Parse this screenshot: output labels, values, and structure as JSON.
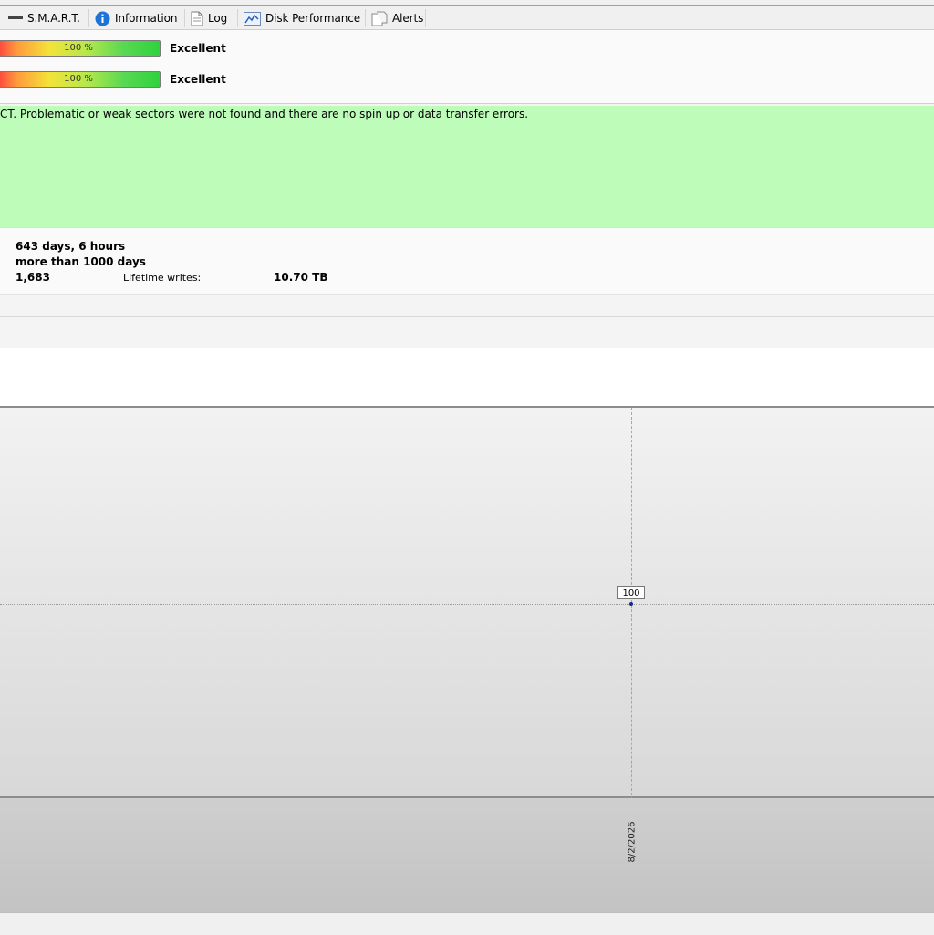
{
  "tabs": [
    {
      "label": "S.M.A.R.T.",
      "icon": "dash-icon"
    },
    {
      "label": "Information",
      "icon": "info-icon"
    },
    {
      "label": "Log",
      "icon": "document-icon"
    },
    {
      "label": "Disk Performance",
      "icon": "performance-chart-icon"
    },
    {
      "label": "Alerts",
      "icon": "alerts-icon"
    }
  ],
  "health": {
    "rows": [
      {
        "percent_text": "100 %",
        "percent": 100,
        "status": "Excellent"
      },
      {
        "percent_text": "100 %",
        "percent": 100,
        "status": "Excellent"
      }
    ]
  },
  "message": {
    "text": "CT. Problematic or weak sectors were not found and there are no spin up or data transfer errors.",
    "background": "#bdfdb9"
  },
  "info": {
    "power_on_time": "643 days, 6 hours",
    "estimated_lifetime": "more than 1000 days",
    "start_stop_count": "1,683",
    "lifetime_writes_label": "Lifetime writes:",
    "lifetime_writes_value": "10.70 TB"
  },
  "chart_data": {
    "type": "line",
    "x": [
      "8/2/2026"
    ],
    "series": [
      {
        "values": [
          100
        ]
      }
    ],
    "data_labels": [
      "100"
    ],
    "grid": true
  }
}
